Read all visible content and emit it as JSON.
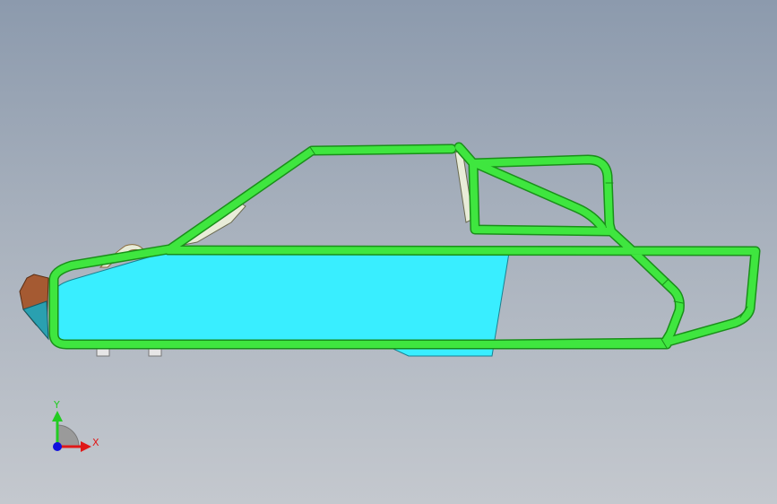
{
  "triad": {
    "y_label": "Y",
    "x_label": "X",
    "y_color": "#22cc22",
    "x_color": "#e01818",
    "z_color": "#1010dd"
  },
  "colors": {
    "frame_tube": "#3fe63f",
    "frame_tube_edge": "#1a8f1a",
    "side_panel": "#39eeff",
    "nose_cone": "#a55a32",
    "nose_panel": "#2aa0b0",
    "windshield": "#e8ecd8"
  }
}
